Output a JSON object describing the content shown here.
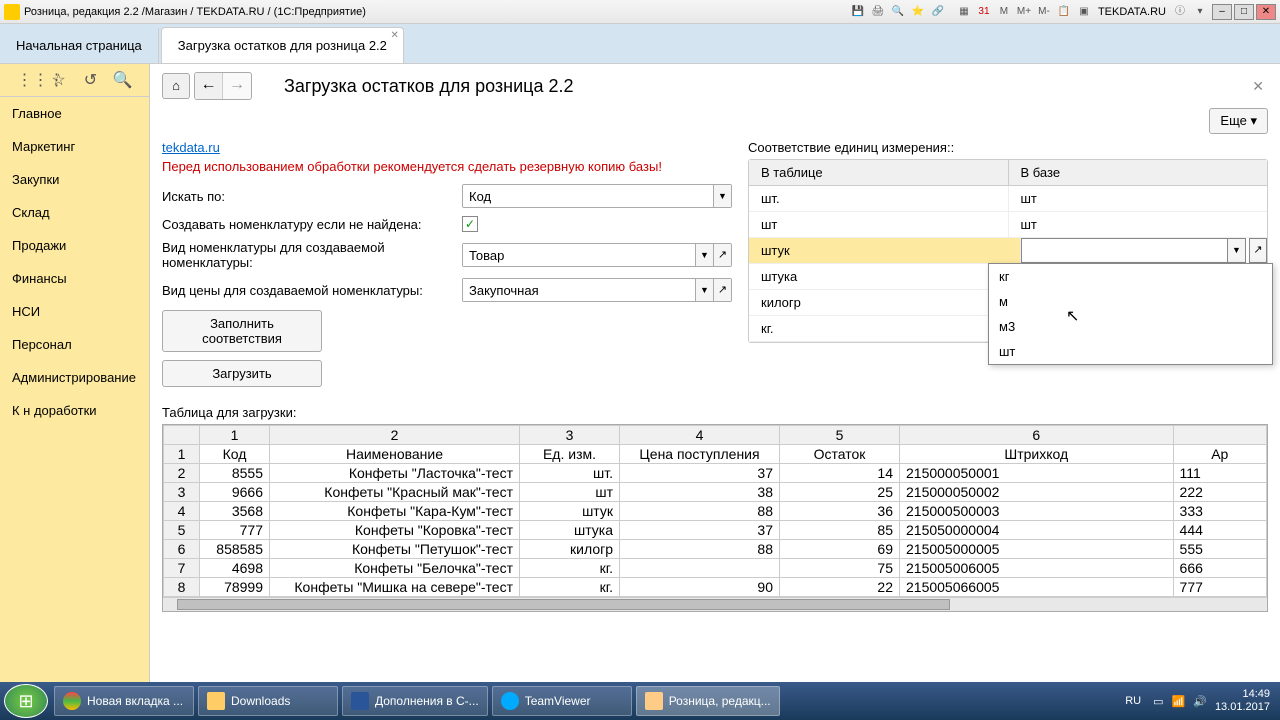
{
  "titlebar": {
    "title": "Розница, редакция 2.2 /Магазин / TEKDATA.RU / (1С:Предприятие)",
    "brand": "TEKDATA.RU"
  },
  "tabs": {
    "start": "Начальная страница",
    "doc": "Загрузка остатков для розница 2.2"
  },
  "sidebar": [
    "Главное",
    "Маркетинг",
    "Закупки",
    "Склад",
    "Продажи",
    "Финансы",
    "НСИ",
    "Персонал",
    "Администрирование",
    "К н доработки"
  ],
  "page": {
    "title": "Загрузка остатков для розница 2.2",
    "more": "Еще ▾",
    "link": "tekdata.ru",
    "warning": "Перед использованием обработки рекомендуется сделать резервную копию базы!",
    "search_by_lbl": "Искать по:",
    "search_by_val": "Код",
    "create_nom_lbl": "Создавать номенклатуру если не найдена:",
    "nom_type_lbl": "Вид номенклатуры для создаваемой номенклатуры:",
    "nom_type_val": "Товар",
    "price_type_lbl": "Вид цены для создаваемой номенклатуры:",
    "price_type_val": "Закупочная",
    "fill_btn": "Заполнить соответствия",
    "load_btn": "Загрузить"
  },
  "units": {
    "title": "Соответствие единиц измерения::",
    "col1": "В таблице",
    "col2": "В базе",
    "rows": [
      {
        "t": "шт.",
        "b": "шт"
      },
      {
        "t": "шт",
        "b": "шт"
      },
      {
        "t": "штук",
        "b": "",
        "selected": true
      },
      {
        "t": "штука",
        "b": ""
      },
      {
        "t": "килогр",
        "b": ""
      },
      {
        "t": "кг.",
        "b": ""
      }
    ],
    "dropdown": [
      "кг",
      "м",
      "м3",
      "шт"
    ]
  },
  "grid": {
    "title": "Таблица для загрузки:",
    "cols": [
      "1",
      "2",
      "3",
      "4",
      "5",
      "6"
    ],
    "headers": [
      "Код",
      "Наименование",
      "Ед. изм.",
      "Цена поступления",
      "Остаток",
      "Штрихкод",
      "Ар"
    ],
    "rows": [
      [
        "1",
        "",
        "",
        "",
        "",
        "",
        "",
        ""
      ],
      [
        "2",
        "8555",
        "Конфеты \"Ласточка\"-тест",
        "шт.",
        "37",
        "14",
        "215000050001",
        "111"
      ],
      [
        "3",
        "9666",
        "Конфеты \"Красный мак\"-тест",
        "шт",
        "38",
        "25",
        "215000050002",
        "222"
      ],
      [
        "4",
        "3568",
        "Конфеты \"Кара-Кум\"-тест",
        "штук",
        "88",
        "36",
        "215000500003",
        "333"
      ],
      [
        "5",
        "777",
        "Конфеты \"Коровка\"-тест",
        "штука",
        "37",
        "85",
        "215050000004",
        "444"
      ],
      [
        "6",
        "858585",
        "Конфеты \"Петушок\"-тест",
        "килогр",
        "88",
        "69",
        "215005000005",
        "555"
      ],
      [
        "7",
        "4698",
        "Конфеты \"Белочка\"-тест",
        "кг.",
        "",
        "75",
        "215005006005",
        "666"
      ],
      [
        "8",
        "78999",
        "Конфеты \"Мишка на севере\"-тест",
        "кг.",
        "90",
        "22",
        "215005066005",
        "777"
      ]
    ]
  },
  "taskbar": {
    "chrome": "Новая вкладка ...",
    "downloads": "Downloads",
    "word": "Дополнения в C-...",
    "teamviewer": "TeamViewer",
    "app": "Розница, редакц...",
    "lang": "RU",
    "time": "14:49",
    "date": "13.01.2017"
  }
}
